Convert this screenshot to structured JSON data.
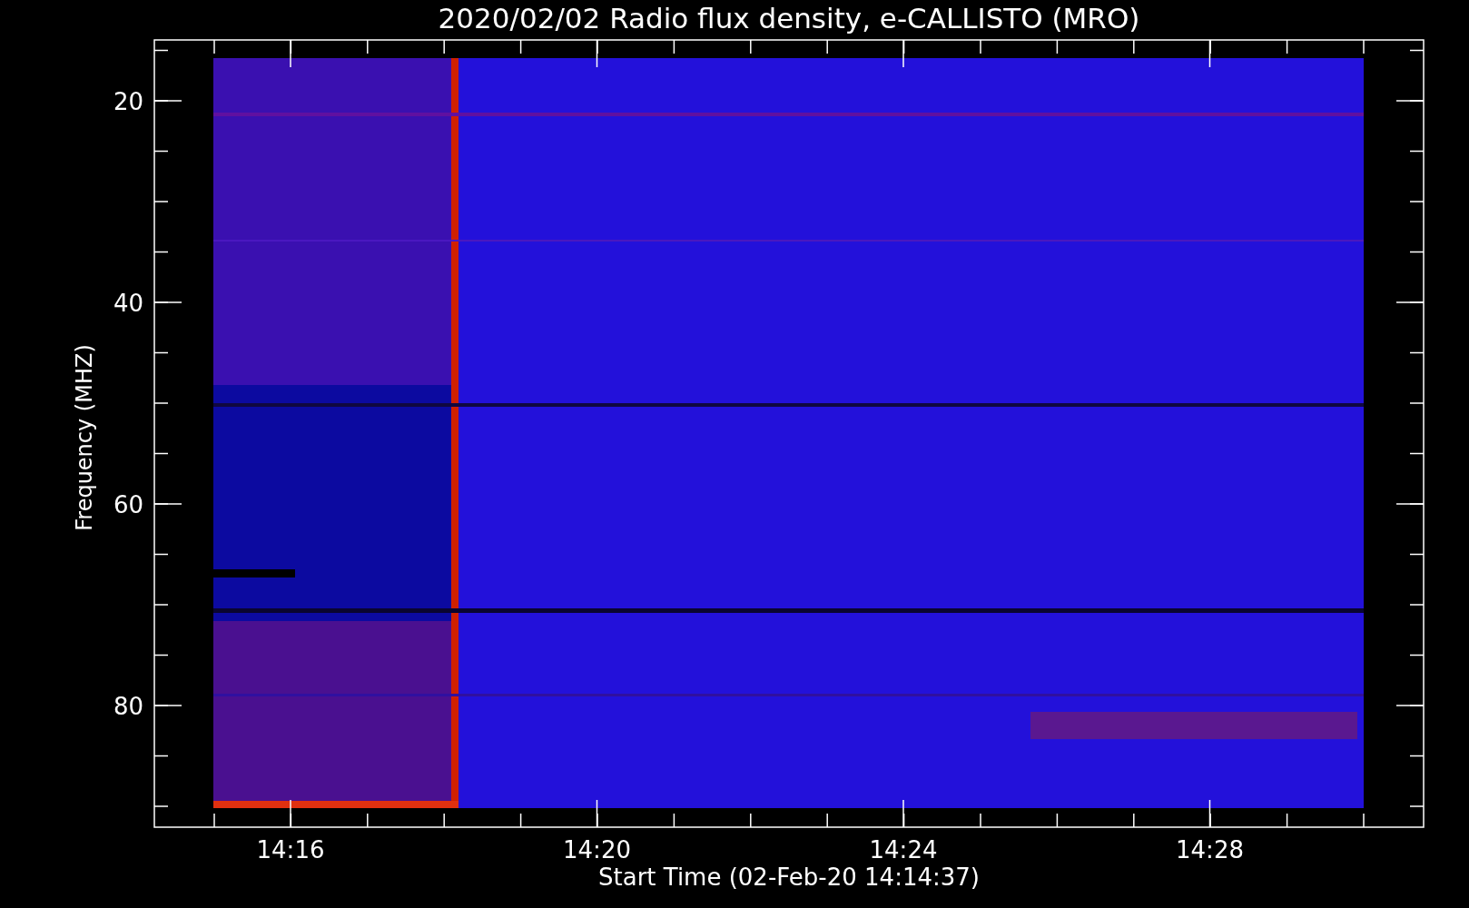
{
  "title": "2020/02/02  Radio flux density, e-CALLISTO (MRO)",
  "ylabel": "Frequency (MHZ)",
  "xlabel": "Start Time (02-Feb-20 14:14:37)",
  "yticks": [
    "20",
    "40",
    "60",
    "80"
  ],
  "xticks": [
    "14:16",
    "14:20",
    "14:24",
    "14:28"
  ]
}
